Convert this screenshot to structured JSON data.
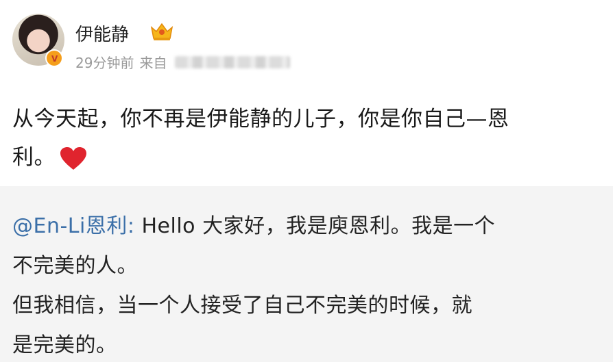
{
  "post": {
    "username": "伊能静",
    "timestamp": "29分钟前",
    "source_prefix": "来自",
    "avatar_icon": "avatar-portrait",
    "verified_icon": "verified-badge-icon",
    "crown_icon": "vip-crown-icon",
    "body_line1": "从今天起，你不再是伊能静的儿子，你是你自己—恩",
    "body_line2": "利。",
    "heart_icon": "red-heart-icon",
    "heart_color": "#e0242e"
  },
  "repost": {
    "mention": "@En-Li恩利",
    "colon": ":",
    "line1_rest": " Hello 大家好，我是庾恩利。我是一个",
    "line2": "不完美的人。",
    "line3": "但我相信，当一个人接受了自己不完美的时候，就",
    "line4": "是完美的。",
    "mention_color": "#3b6fa8",
    "background": "#f4f4f4"
  }
}
